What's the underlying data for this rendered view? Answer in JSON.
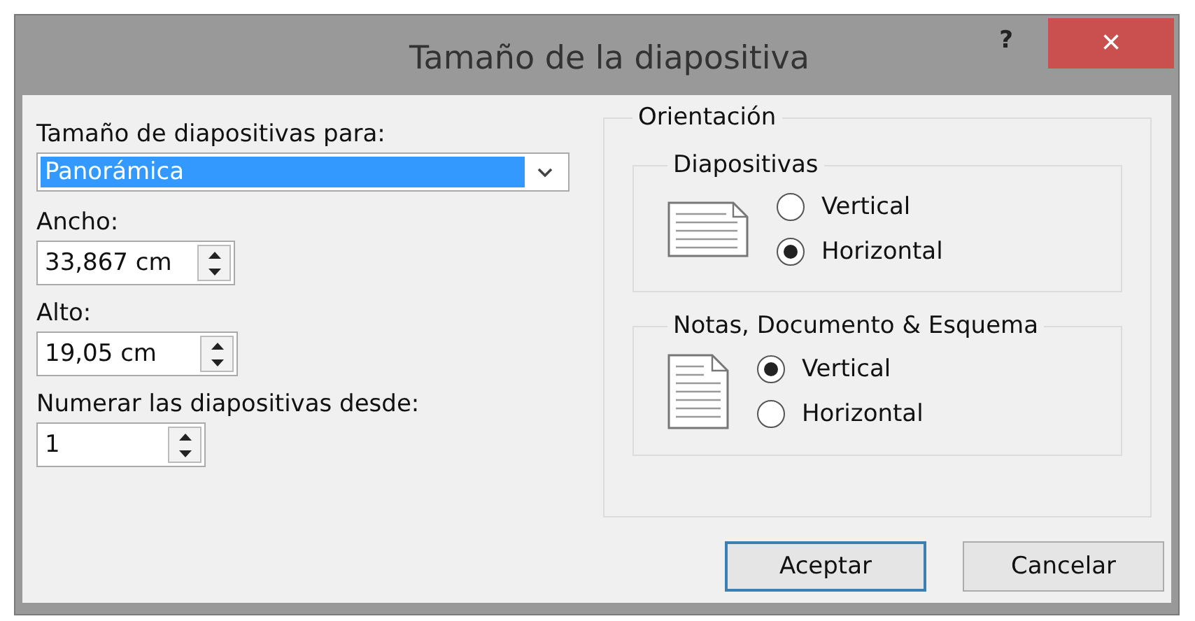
{
  "window": {
    "title": "Tamaño de la diapositiva",
    "help": "?",
    "close": "×"
  },
  "size_for": {
    "label": "Tamaño de diapositivas para:",
    "value": "Panorámica"
  },
  "fields": [
    {
      "label": "Ancho:",
      "value": "33,867 cm"
    },
    {
      "label": "Alto:",
      "value": "19,05 cm"
    },
    {
      "label": "Numerar las diapositivas desde:",
      "value": "1"
    }
  ],
  "orientation": {
    "title": "Orientación",
    "groups": [
      {
        "title": "Diapositivas",
        "kind": "landscape",
        "options": [
          {
            "label": "Vertical",
            "selected": false
          },
          {
            "label": "Horizontal",
            "selected": true
          }
        ]
      },
      {
        "title": "Notas, Documento & Esquema",
        "kind": "portrait",
        "options": [
          {
            "label": "Vertical",
            "selected": true
          },
          {
            "label": "Horizontal",
            "selected": false
          }
        ]
      }
    ]
  },
  "buttons": [
    {
      "label": "Aceptar",
      "default": true
    },
    {
      "label": "Cancelar",
      "default": false
    }
  ]
}
